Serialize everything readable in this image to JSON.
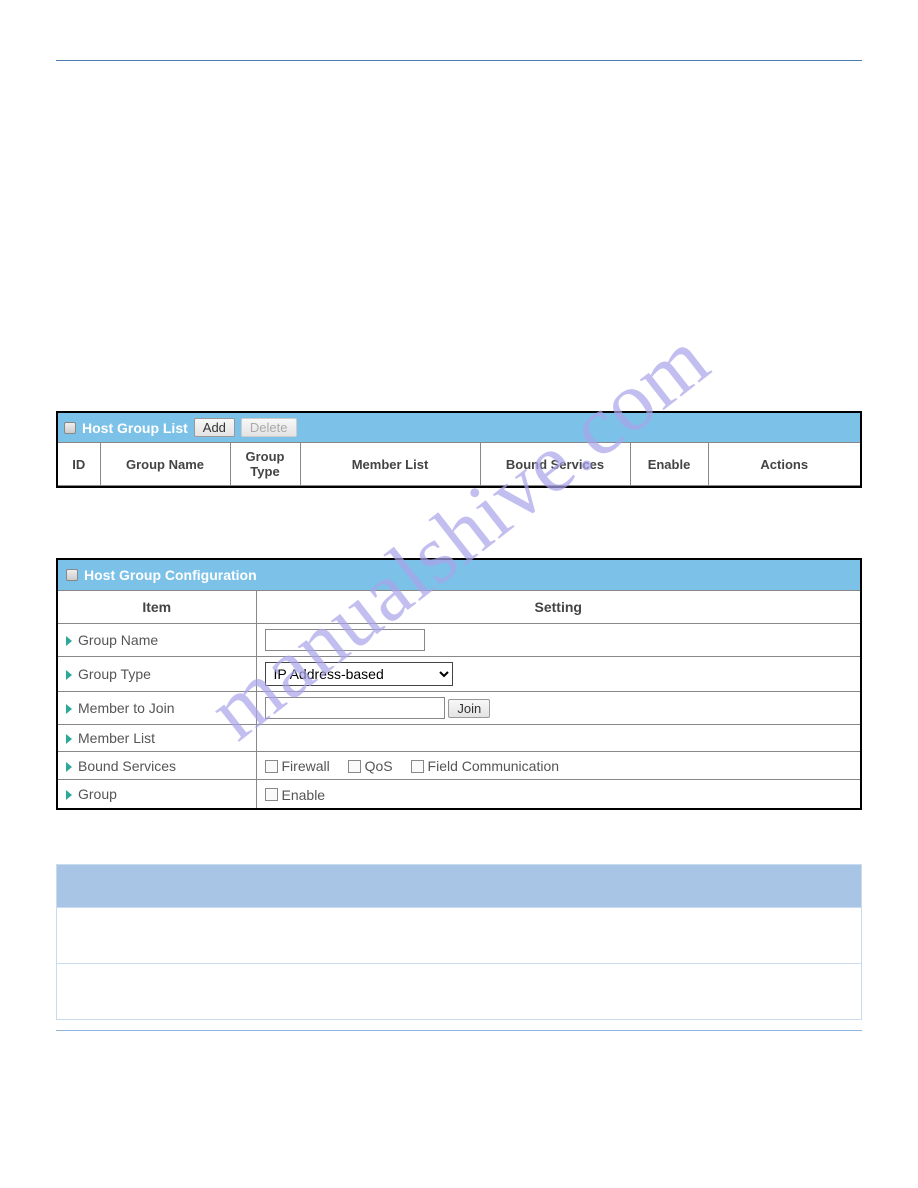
{
  "watermark": "manualshive.com",
  "list_panel": {
    "title": "Host Group List",
    "add_label": "Add",
    "delete_label": "Delete",
    "columns": [
      "ID",
      "Group Name",
      "Group Type",
      "Member List",
      "Bound Services",
      "Enable",
      "Actions"
    ]
  },
  "cfg_panel": {
    "title": "Host Group Configuration",
    "head_item": "Item",
    "head_setting": "Setting",
    "rows": {
      "group_name": "Group Name",
      "group_type": "Group Type",
      "group_type_value": "IP Address-based",
      "member_to_join": "Member to Join",
      "join_btn": "Join",
      "member_list": "Member List",
      "bound_services": "Bound Services",
      "svc_firewall": "Firewall",
      "svc_qos": "QoS",
      "svc_fieldcomm": "Field Communication",
      "group": "Group",
      "enable_label": "Enable"
    }
  }
}
